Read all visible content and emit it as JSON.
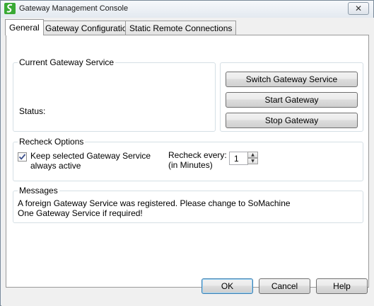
{
  "window": {
    "title": "Gateway Management Console",
    "close_glyph": "✕",
    "app_icon": "schneider-app-icon"
  },
  "tabs": [
    {
      "label": "General",
      "active": true
    },
    {
      "label": "Gateway Configuration",
      "active": false
    },
    {
      "label": "Static Remote Connections",
      "active": false
    }
  ],
  "current_service": {
    "legend": "Current Gateway Service",
    "status_label": "Status:",
    "status_value": ""
  },
  "service_buttons": {
    "switch": "Switch Gateway Service",
    "start": "Start Gateway",
    "stop": "Stop Gateway"
  },
  "recheck": {
    "legend": "Recheck Options",
    "keep_active_line1": "Keep selected Gateway Service",
    "keep_active_line2": "always active",
    "keep_active_checked": true,
    "interval_label_line1": "Recheck every:",
    "interval_label_line2": "(in Minutes)",
    "interval_value": "1"
  },
  "messages": {
    "legend": "Messages",
    "line1": "A foreign Gateway Service was registered. Please change to SoMachine",
    "line2": "One Gateway Service if required!"
  },
  "footer": {
    "ok": "OK",
    "cancel": "Cancel",
    "help": "Help"
  }
}
